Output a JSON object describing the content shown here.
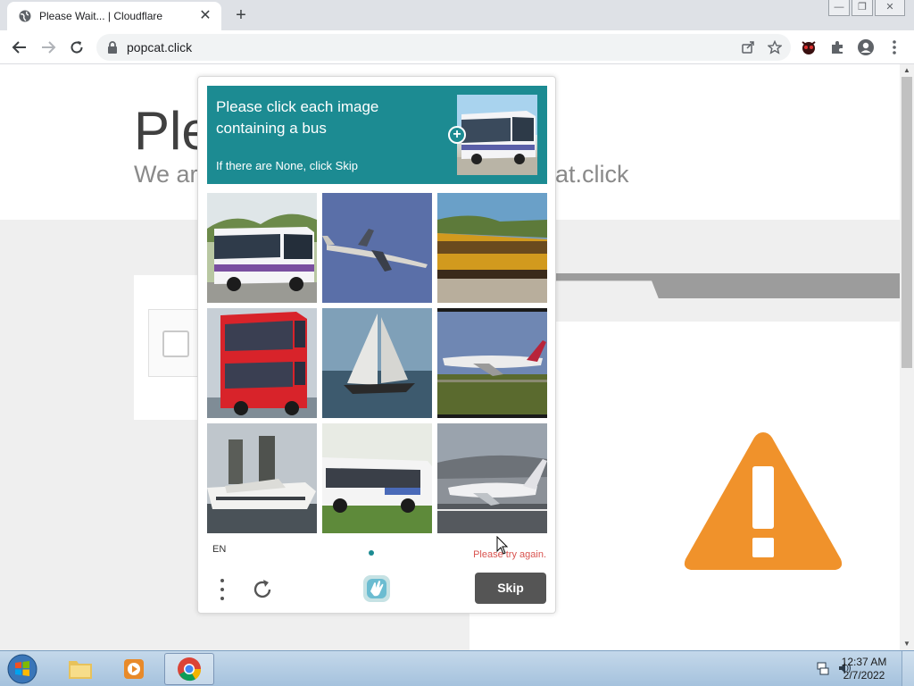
{
  "browser": {
    "tab_title": "Please Wait... | Cloudflare",
    "new_tab_label": "+",
    "close_tab_label": "✕",
    "url": "popcat.click",
    "window_buttons": [
      "—",
      "❐",
      "✕"
    ]
  },
  "page": {
    "heading_partial": "Ple",
    "subheading_partial_left": "We ar",
    "subheading_partial_right": "at.click"
  },
  "captcha": {
    "prompt": "Please click each image containing a bus",
    "hint": "If there are None, click Skip",
    "plus_label": "+",
    "tiles": [
      {
        "subject": "bus"
      },
      {
        "subject": "airplane"
      },
      {
        "subject": "train"
      },
      {
        "subject": "double-decker-bus"
      },
      {
        "subject": "sailboat"
      },
      {
        "subject": "airplane"
      },
      {
        "subject": "yacht"
      },
      {
        "subject": "bus"
      },
      {
        "subject": "airplane"
      }
    ],
    "language": "EN",
    "error": "Please try again.",
    "skip_label": "Skip",
    "accent_color": "#1c8b92"
  },
  "taskbar": {
    "time": "12:37 AM",
    "date": "2/7/2022"
  },
  "colors": {
    "warning": "#f0922b",
    "skip_button": "#555555"
  }
}
